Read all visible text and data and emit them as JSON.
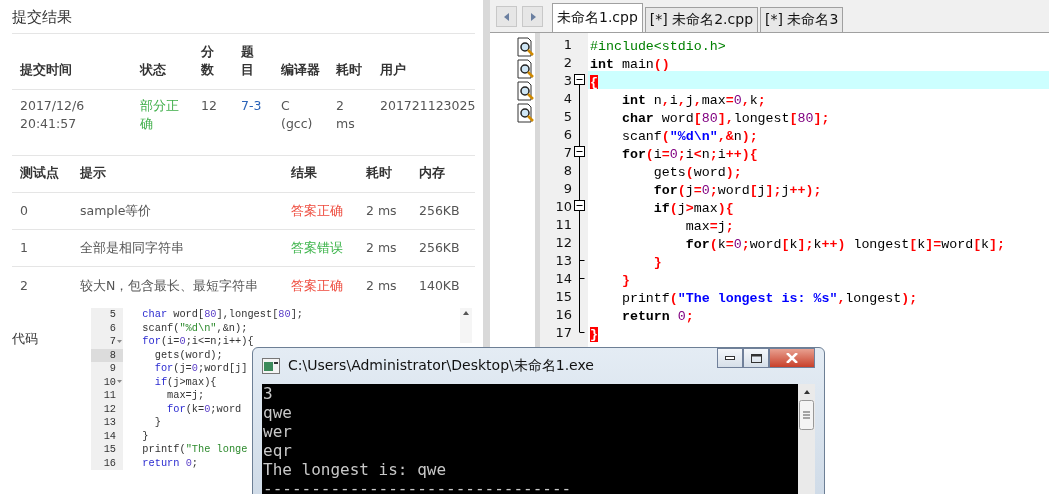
{
  "submission": {
    "title": "提交结果",
    "summary": {
      "columns": [
        "提交时间",
        "状态",
        "分数",
        "题目",
        "编译器",
        "耗时",
        "用户"
      ],
      "row": [
        {
          "text": "2017/12/6 20:41:57",
          "kind": "plain"
        },
        {
          "text": "部分正确",
          "kind": "status"
        },
        {
          "text": "12",
          "kind": "plain"
        },
        {
          "text": "7-3",
          "kind": "link"
        },
        {
          "text": "C (gcc)",
          "kind": "plain"
        },
        {
          "text": "2 ms",
          "kind": "plain"
        },
        {
          "text": "201721123025",
          "kind": "plain"
        }
      ]
    },
    "tests": {
      "columns": [
        "测试点",
        "提示",
        "结果",
        "耗时",
        "内存"
      ],
      "rows": [
        {
          "id": "0",
          "hint": "sample等价",
          "result": "答案正确",
          "color": "#ee4a3c",
          "time": "2 ms",
          "memory": "256KB"
        },
        {
          "id": "1",
          "hint": "全部是相同字符串",
          "result": "答案错误",
          "color": "#3cb44a",
          "time": "2 ms",
          "memory": "256KB"
        },
        {
          "id": "2",
          "hint": "较大N，包含最长、最短字符串",
          "result": "答案正确",
          "color": "#ee4a3c",
          "time": "2 ms",
          "memory": "140KB"
        }
      ]
    },
    "code_label": "代码",
    "code": {
      "lines": [
        {
          "number": "5",
          "collapsible": false,
          "current": false,
          "tokens": [
            {
              "text": "  char",
              "kind": "kw"
            },
            {
              "text": " word["
            },
            {
              "text": "80",
              "kind": "num"
            },
            {
              "text": "],longest["
            },
            {
              "text": "80",
              "kind": "num"
            },
            {
              "text": "];"
            }
          ]
        },
        {
          "number": "6",
          "collapsible": false,
          "current": false,
          "tokens": [
            {
              "text": "  scanf("
            },
            {
              "text": "\"%d\\n\"",
              "kind": "str"
            },
            {
              "text": ",&n);"
            }
          ]
        },
        {
          "number": "7",
          "collapsible": true,
          "current": false,
          "tokens": [
            {
              "text": "  for",
              "kind": "kw"
            },
            {
              "text": "(i="
            },
            {
              "text": "0",
              "kind": "num"
            },
            {
              "text": ";i<=n;i++){"
            }
          ]
        },
        {
          "number": "8",
          "collapsible": false,
          "current": true,
          "tokens": [
            {
              "text": "    gets(word);"
            }
          ]
        },
        {
          "number": "9",
          "collapsible": false,
          "current": false,
          "tokens": [
            {
              "text": "    for",
              "kind": "kw"
            },
            {
              "text": "(j="
            },
            {
              "text": "0",
              "kind": "num"
            },
            {
              "text": ";word[j]"
            }
          ]
        },
        {
          "number": "10",
          "collapsible": true,
          "current": false,
          "tokens": [
            {
              "text": "    if",
              "kind": "kw"
            },
            {
              "text": "(j>max){"
            }
          ]
        },
        {
          "number": "11",
          "collapsible": false,
          "current": false,
          "tokens": [
            {
              "text": "      max=j;"
            }
          ]
        },
        {
          "number": "12",
          "collapsible": false,
          "current": false,
          "tokens": [
            {
              "text": "      for",
              "kind": "kw"
            },
            {
              "text": "(k="
            },
            {
              "text": "0",
              "kind": "num"
            },
            {
              "text": ";word"
            }
          ]
        },
        {
          "number": "13",
          "collapsible": false,
          "current": false,
          "tokens": [
            {
              "text": "    }"
            }
          ]
        },
        {
          "number": "14",
          "collapsible": false,
          "current": false,
          "tokens": [
            {
              "text": "  }"
            }
          ]
        },
        {
          "number": "15",
          "collapsible": false,
          "current": false,
          "tokens": [
            {
              "text": "  printf("
            },
            {
              "text": "\"The longe",
              "kind": "str"
            }
          ]
        },
        {
          "number": "16",
          "collapsible": false,
          "current": false,
          "tokens": [
            {
              "text": "  return ",
              "kind": "kw"
            },
            {
              "text": "0",
              "kind": "num"
            },
            {
              "text": ";"
            }
          ]
        }
      ]
    }
  },
  "ide": {
    "tabs": [
      {
        "label": "未命名1.cpp",
        "selected": true
      },
      {
        "label": "[*] 未命名2.cpp",
        "selected": false
      },
      {
        "label": "[*] 未命名3",
        "selected": false
      }
    ],
    "editor": {
      "lines": [
        {
          "number": "1",
          "collapsible": false,
          "block_end": false,
          "current": false,
          "tokens": [
            {
              "text": "#include<stdio.h>",
              "kind": "pre"
            }
          ]
        },
        {
          "number": "2",
          "collapsible": false,
          "block_end": false,
          "current": false,
          "tokens": [
            {
              "text": "int",
              "kind": "kw"
            },
            {
              "text": " main"
            },
            {
              "text": "()",
              "kind": "sym"
            }
          ]
        },
        {
          "number": "3",
          "collapsible": true,
          "block_end": false,
          "current": true,
          "tokens": [
            {
              "text": "{",
              "kind": "brace"
            }
          ]
        },
        {
          "number": "4",
          "collapsible": false,
          "block_end": false,
          "current": false,
          "tokens": [
            {
              "text": "    int",
              "kind": "kw"
            },
            {
              "text": " n"
            },
            {
              "text": ",",
              "kind": "sym"
            },
            {
              "text": "i"
            },
            {
              "text": ",",
              "kind": "sym"
            },
            {
              "text": "j"
            },
            {
              "text": ",",
              "kind": "sym"
            },
            {
              "text": "max"
            },
            {
              "text": "=",
              "kind": "sym"
            },
            {
              "text": "0",
              "kind": "num"
            },
            {
              "text": ",",
              "kind": "sym"
            },
            {
              "text": "k"
            },
            {
              "text": ";",
              "kind": "sym"
            }
          ]
        },
        {
          "number": "5",
          "collapsible": false,
          "block_end": false,
          "current": false,
          "tokens": [
            {
              "text": "    char",
              "kind": "kw"
            },
            {
              "text": " word"
            },
            {
              "text": "[",
              "kind": "sym"
            },
            {
              "text": "80",
              "kind": "num"
            },
            {
              "text": "],",
              "kind": "sym"
            },
            {
              "text": "longest"
            },
            {
              "text": "[",
              "kind": "sym"
            },
            {
              "text": "80",
              "kind": "num"
            },
            {
              "text": "];",
              "kind": "sym"
            }
          ]
        },
        {
          "number": "6",
          "collapsible": false,
          "block_end": false,
          "current": false,
          "tokens": [
            {
              "text": "    scanf"
            },
            {
              "text": "(",
              "kind": "sym"
            },
            {
              "text": "\"%d\\n\"",
              "kind": "str"
            },
            {
              "text": ",&",
              "kind": "sym"
            },
            {
              "text": "n"
            },
            {
              "text": ");",
              "kind": "sym"
            }
          ]
        },
        {
          "number": "7",
          "collapsible": true,
          "block_end": false,
          "current": false,
          "tokens": [
            {
              "text": "    for",
              "kind": "kw"
            },
            {
              "text": "(",
              "kind": "sym"
            },
            {
              "text": "i"
            },
            {
              "text": "=",
              "kind": "sym"
            },
            {
              "text": "0",
              "kind": "num"
            },
            {
              "text": ";",
              "kind": "sym"
            },
            {
              "text": "i"
            },
            {
              "text": "<",
              "kind": "sym"
            },
            {
              "text": "n"
            },
            {
              "text": ";",
              "kind": "sym"
            },
            {
              "text": "i"
            },
            {
              "text": "++){",
              "kind": "sym"
            }
          ]
        },
        {
          "number": "8",
          "collapsible": false,
          "block_end": false,
          "current": false,
          "tokens": [
            {
              "text": "        gets"
            },
            {
              "text": "(",
              "kind": "sym"
            },
            {
              "text": "word"
            },
            {
              "text": ");",
              "kind": "sym"
            }
          ]
        },
        {
          "number": "9",
          "collapsible": false,
          "block_end": false,
          "current": false,
          "tokens": [
            {
              "text": "        for",
              "kind": "kw"
            },
            {
              "text": "(",
              "kind": "sym"
            },
            {
              "text": "j"
            },
            {
              "text": "=",
              "kind": "sym"
            },
            {
              "text": "0",
              "kind": "num"
            },
            {
              "text": ";",
              "kind": "sym"
            },
            {
              "text": "word"
            },
            {
              "text": "[",
              "kind": "sym"
            },
            {
              "text": "j"
            },
            {
              "text": "];",
              "kind": "sym"
            },
            {
              "text": "j"
            },
            {
              "text": "++);",
              "kind": "sym"
            }
          ]
        },
        {
          "number": "10",
          "collapsible": true,
          "block_end": false,
          "current": false,
          "tokens": [
            {
              "text": "        if",
              "kind": "kw"
            },
            {
              "text": "(",
              "kind": "sym"
            },
            {
              "text": "j"
            },
            {
              "text": ">",
              "kind": "sym"
            },
            {
              "text": "max"
            },
            {
              "text": "){",
              "kind": "sym"
            }
          ]
        },
        {
          "number": "11",
          "collapsible": false,
          "block_end": false,
          "current": false,
          "tokens": [
            {
              "text": "            max"
            },
            {
              "text": "=",
              "kind": "sym"
            },
            {
              "text": "j"
            },
            {
              "text": ";",
              "kind": "sym"
            }
          ]
        },
        {
          "number": "12",
          "collapsible": false,
          "block_end": false,
          "current": false,
          "tokens": [
            {
              "text": "            for",
              "kind": "kw"
            },
            {
              "text": "(",
              "kind": "sym"
            },
            {
              "text": "k"
            },
            {
              "text": "=",
              "kind": "sym"
            },
            {
              "text": "0",
              "kind": "num"
            },
            {
              "text": ";",
              "kind": "sym"
            },
            {
              "text": "word"
            },
            {
              "text": "[",
              "kind": "sym"
            },
            {
              "text": "k"
            },
            {
              "text": "];",
              "kind": "sym"
            },
            {
              "text": "k"
            },
            {
              "text": "++)",
              "kind": "sym"
            },
            {
              "text": " longest"
            },
            {
              "text": "[",
              "kind": "sym"
            },
            {
              "text": "k"
            },
            {
              "text": "]=",
              "kind": "sym"
            },
            {
              "text": "word"
            },
            {
              "text": "[",
              "kind": "sym"
            },
            {
              "text": "k"
            },
            {
              "text": "];",
              "kind": "sym"
            }
          ]
        },
        {
          "number": "13",
          "collapsible": false,
          "block_end": true,
          "current": false,
          "tokens": [
            {
              "text": "        }",
              "kind": "sym"
            }
          ]
        },
        {
          "number": "14",
          "collapsible": false,
          "block_end": true,
          "current": false,
          "tokens": [
            {
              "text": "    }",
              "kind": "sym"
            }
          ]
        },
        {
          "number": "15",
          "collapsible": false,
          "block_end": false,
          "current": false,
          "tokens": [
            {
              "text": "    printf"
            },
            {
              "text": "(",
              "kind": "sym"
            },
            {
              "text": "\"The longest is: %s\"",
              "kind": "str"
            },
            {
              "text": ",",
              "kind": "sym"
            },
            {
              "text": "longest"
            },
            {
              "text": ");",
              "kind": "sym"
            }
          ]
        },
        {
          "number": "16",
          "collapsible": false,
          "block_end": false,
          "current": false,
          "tokens": [
            {
              "text": "    return ",
              "kind": "kw"
            },
            {
              "text": "0",
              "kind": "num"
            },
            {
              "text": ";",
              "kind": "sym"
            }
          ]
        },
        {
          "number": "17",
          "collapsible": false,
          "block_end": true,
          "current": false,
          "tokens": [
            {
              "text": "}",
              "kind": "brace"
            }
          ]
        }
      ]
    }
  },
  "console": {
    "title": "C:\\Users\\Administrator\\Desktop\\未命名1.exe",
    "lines": [
      "3",
      "qwe",
      "wer",
      "eqr",
      "The longest is: qwe",
      "--------------------------------"
    ]
  }
}
